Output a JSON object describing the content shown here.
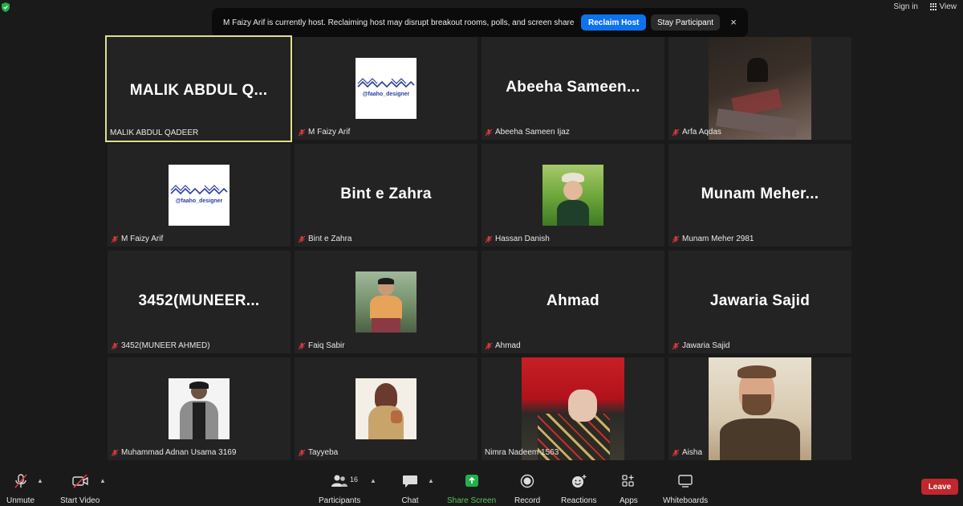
{
  "topbar": {
    "signin": "Sign in",
    "view": "View"
  },
  "banner": {
    "message": "M Faizy Arif is currently host. Reclaiming host may disrupt breakout rooms, polls, and screen share",
    "reclaim": "Reclaim Host",
    "stay": "Stay Participant",
    "close": "×"
  },
  "tiles": [
    {
      "big": "MALIK ABDUL Q...",
      "label": "MALIK ABDUL QADEER"
    },
    {
      "logo": "@faaho_designer",
      "label": "M Faizy Arif"
    },
    {
      "big": "Abeeha  Sameen...",
      "label": "Abeeha Sameen Ijaz"
    },
    {
      "label": "Arfa Aqdas"
    },
    {
      "logo": "@faaho_designer",
      "label": "M Faizy Arif"
    },
    {
      "big": "Bint e Zahra",
      "label": "Bint e Zahra"
    },
    {
      "label": "Hassan Danish"
    },
    {
      "big": "Munam  Meher...",
      "label": "Munam Meher 2981"
    },
    {
      "big": "3452(MUNEER...",
      "label": "3452(MUNEER AHMED)"
    },
    {
      "label": "Faiq Sabir"
    },
    {
      "big": "Ahmad",
      "label": "Ahmad"
    },
    {
      "big": "Jawaria Sajid",
      "label": "Jawaria Sajid"
    },
    {
      "label": "Muhammad Adnan Usama 3169"
    },
    {
      "label": "Tayyeba"
    },
    {
      "label": "Nimra Nadeem 1563"
    },
    {
      "label": "Aisha"
    }
  ],
  "toolbar": {
    "unmute": "Unmute",
    "start_video": "Start Video",
    "participants": "Participants",
    "participants_count": "16",
    "chat": "Chat",
    "share_screen": "Share Screen",
    "record": "Record",
    "reactions": "Reactions",
    "apps": "Apps",
    "whiteboards": "Whiteboards",
    "leave": "Leave"
  },
  "colors": {
    "background": "#1a1a1a",
    "tile": "#232323",
    "active_border": "#dde08a",
    "reclaim_blue": "#0e72ed",
    "leave_red": "#c1272d",
    "share_green": "#23b04a",
    "muted_red": "#e0393e"
  }
}
